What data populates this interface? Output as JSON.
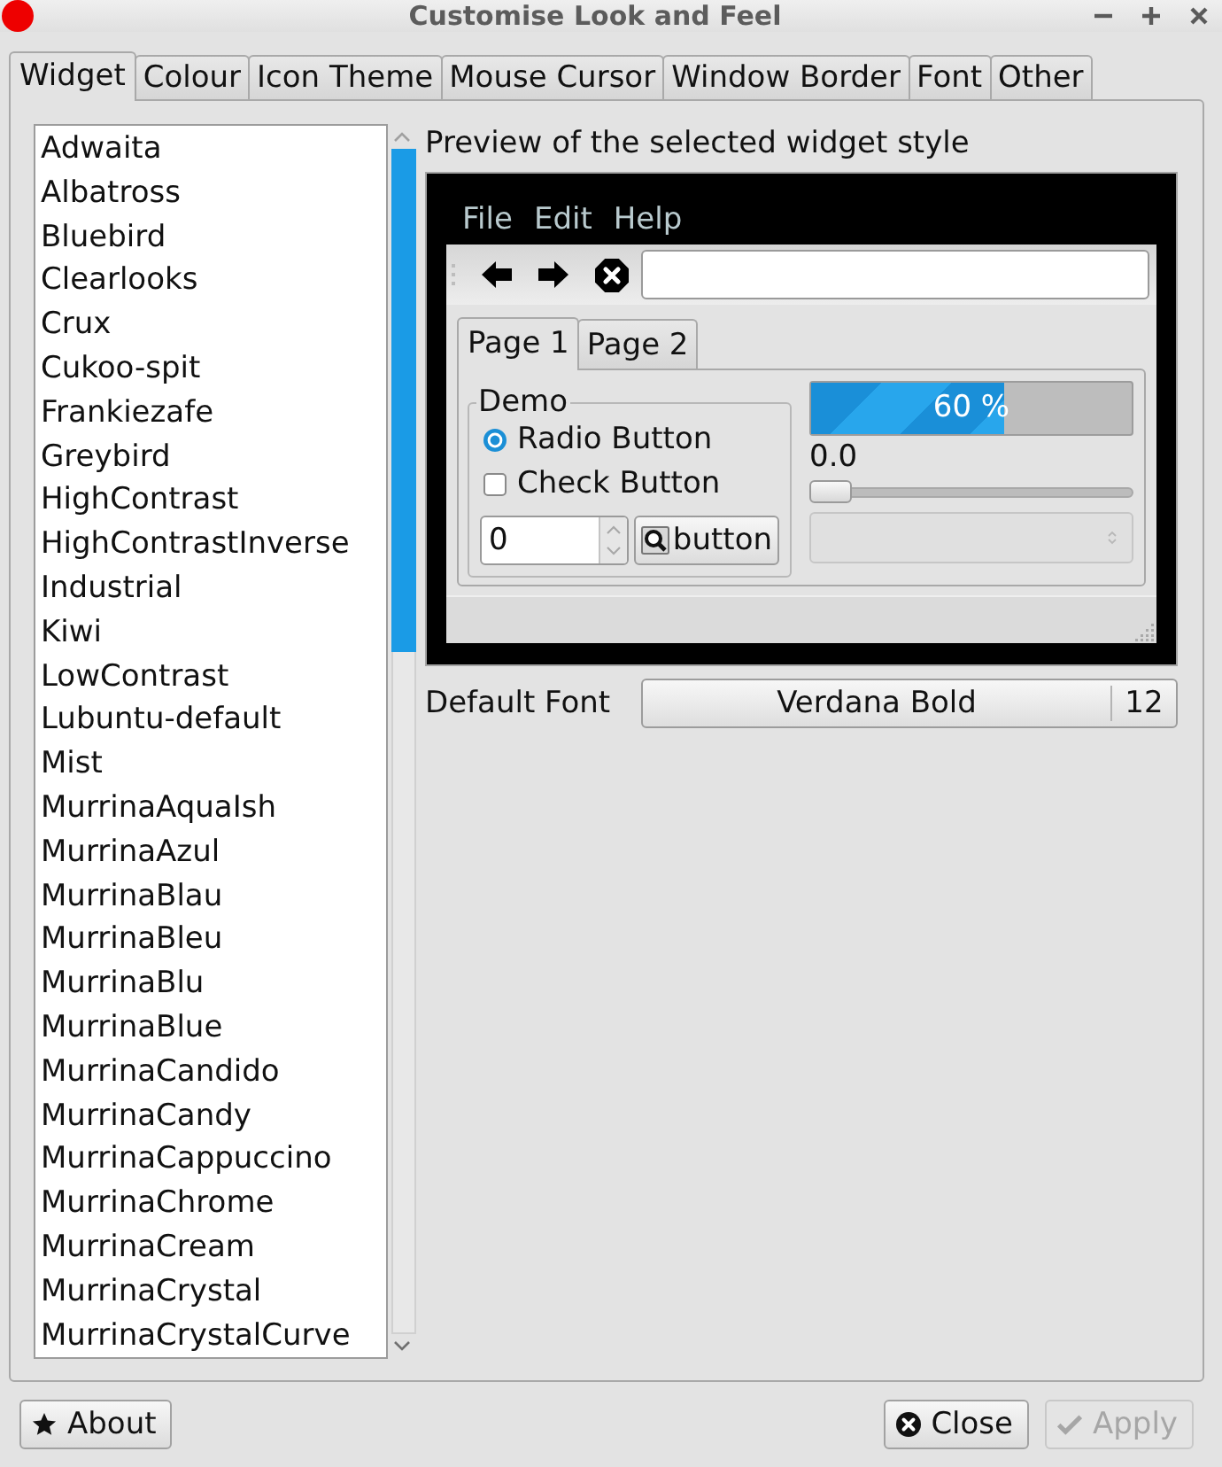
{
  "window": {
    "title": "Customise Look and Feel"
  },
  "tabs": [
    {
      "label": "Widget",
      "selected": true
    },
    {
      "label": "Colour",
      "selected": false
    },
    {
      "label": "Icon Theme",
      "selected": false
    },
    {
      "label": "Mouse Cursor",
      "selected": false
    },
    {
      "label": "Window Border",
      "selected": false
    },
    {
      "label": "Font",
      "selected": false
    },
    {
      "label": "Other",
      "selected": false
    }
  ],
  "theme_list": {
    "items": [
      {
        "label": "Adwaita",
        "selected": false
      },
      {
        "label": "Albatross",
        "selected": false
      },
      {
        "label": "Bluebird",
        "selected": false
      },
      {
        "label": "Clearlooks",
        "selected": false
      },
      {
        "label": "Crux",
        "selected": false
      },
      {
        "label": "Cukoo-spit",
        "selected": false
      },
      {
        "label": "Frankiezafe",
        "selected": false
      },
      {
        "label": "Greybird",
        "selected": false
      },
      {
        "label": "HighContrast",
        "selected": false
      },
      {
        "label": "HighContrastInverse",
        "selected": false
      },
      {
        "label": "Industrial",
        "selected": false
      },
      {
        "label": "Kiwi",
        "selected": false
      },
      {
        "label": "LowContrast",
        "selected": false
      },
      {
        "label": "Lubuntu-default",
        "selected": false
      },
      {
        "label": "Mist",
        "selected": false
      },
      {
        "label": "MurrinaAquaIsh",
        "selected": false
      },
      {
        "label": "MurrinaAzul",
        "selected": false
      },
      {
        "label": "MurrinaBlau",
        "selected": false
      },
      {
        "label": "MurrinaBleu",
        "selected": false
      },
      {
        "label": "MurrinaBlu",
        "selected": false
      },
      {
        "label": "MurrinaBlue",
        "selected": false
      },
      {
        "label": "MurrinaCandido",
        "selected": false
      },
      {
        "label": "MurrinaCandy",
        "selected": false
      },
      {
        "label": "MurrinaCappuccino",
        "selected": false
      },
      {
        "label": "MurrinaChrome",
        "selected": false
      },
      {
        "label": "MurrinaCream",
        "selected": false
      },
      {
        "label": "MurrinaCrystal",
        "selected": false
      },
      {
        "label": "MurrinaCrystalCurve",
        "selected": false
      }
    ]
  },
  "preview": {
    "title": "Preview of the selected widget style",
    "menu": [
      "File",
      "Edit",
      "Help"
    ],
    "pages": [
      {
        "label": "Page 1",
        "selected": true
      },
      {
        "label": "Page 2",
        "selected": false
      }
    ],
    "demo": {
      "title": "Demo",
      "radio": {
        "label": "Radio Button",
        "checked": true
      },
      "check": {
        "label": "Check Button",
        "checked": false
      },
      "spin_value": "0",
      "button": "button"
    },
    "progress": {
      "level": 0.6,
      "text": "60 %"
    },
    "scale": {
      "reading": "0.0",
      "level": 0
    },
    "combo": {
      "disabled": true
    }
  },
  "default_font": {
    "label": "Default Font",
    "font": "Verdana Bold",
    "size": "12"
  },
  "buttons": [
    {
      "kind": "about",
      "label": "About",
      "disabled": false
    },
    {
      "kind": "close",
      "label": "Close",
      "disabled": false
    },
    {
      "kind": "apply",
      "label": "Apply",
      "disabled": true
    }
  ]
}
